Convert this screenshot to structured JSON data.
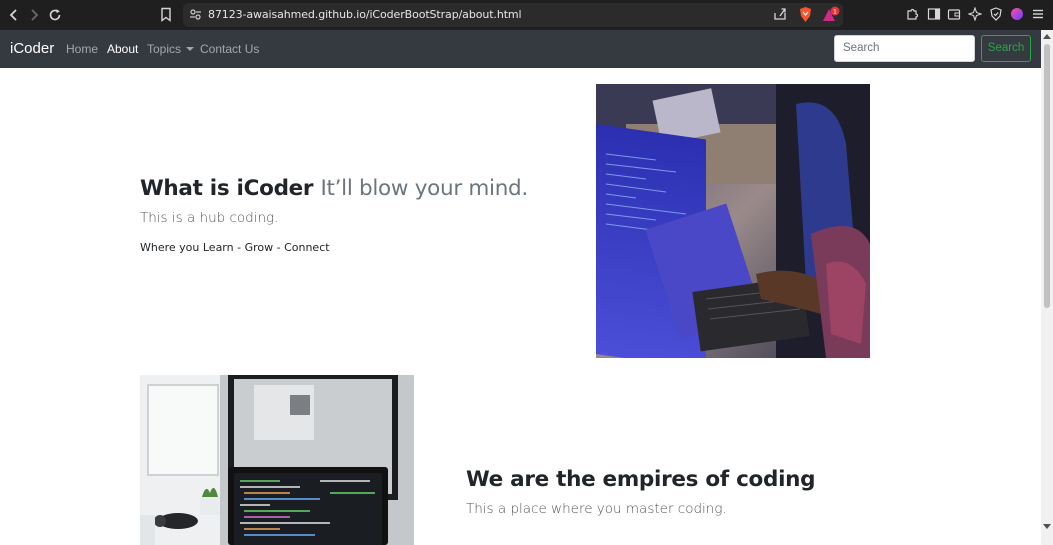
{
  "browser": {
    "url_host": "87123-awaisahmed.github.io",
    "url_path": "/iCoderBootStrap/about.html",
    "notification_count": "1"
  },
  "navbar": {
    "brand": "iCoder",
    "links": [
      {
        "label": "Home"
      },
      {
        "label": "About"
      },
      {
        "label": "Topics"
      },
      {
        "label": "Contact Us"
      }
    ],
    "search_placeholder": "Search",
    "search_button": "Search"
  },
  "featurette_one": {
    "heading": "What is iCoder",
    "heading_muted": "It’ll blow your mind.",
    "lead": "This is a hub coding.",
    "tagline": "Where you Learn - Grow - Connect"
  },
  "featurette_two": {
    "heading": "We are the empires of coding",
    "lead": "This a place where you master coding."
  },
  "colors": {
    "navbar_bg": "#343a40",
    "search_accent": "#28a745",
    "browser_chrome": "#1f1f1f"
  }
}
